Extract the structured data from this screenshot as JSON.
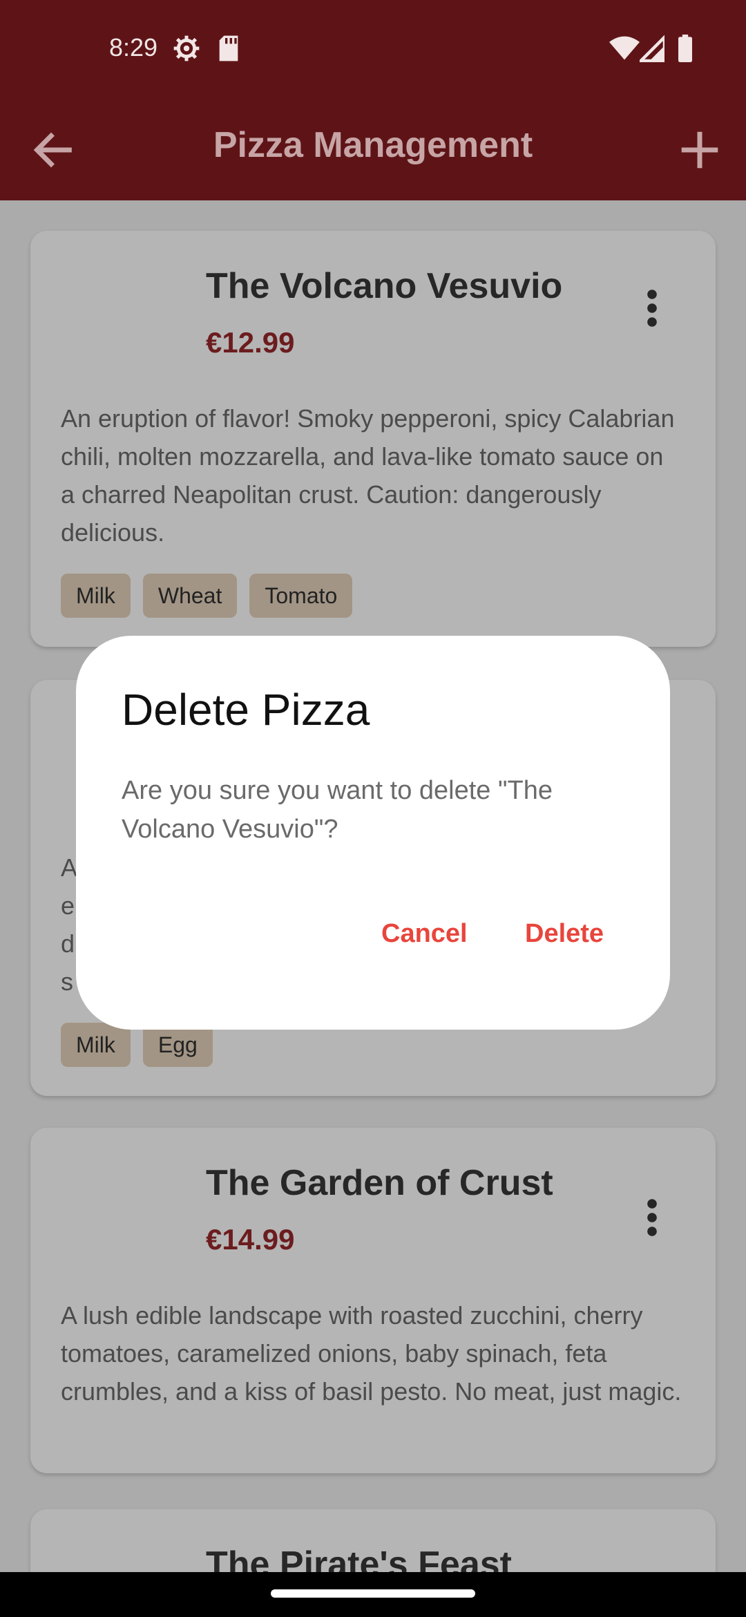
{
  "status_bar": {
    "time": "8:29",
    "icons": [
      "settings-gear-icon",
      "sd-card-icon",
      "wifi-icon",
      "cell-signal-icon",
      "battery-icon"
    ]
  },
  "app_bar": {
    "title": "Pizza Management",
    "back_icon": "arrow-left-icon",
    "add_icon": "plus-icon"
  },
  "pizzas": [
    {
      "name": "The Volcano Vesuvio",
      "price": "€12.99",
      "description": "An eruption of flavor! Smoky pepperoni, spicy Calabrian chili, molten mozzarella, and lava-like tomato sauce on a charred Neapolitan crust. Caution: dangerously delicious.",
      "allergens": [
        "Milk",
        "Wheat",
        "Tomato"
      ]
    },
    {
      "name": "",
      "price": "",
      "description_fragments": [
        "A",
        "e",
        "d",
        "s"
      ],
      "allergens": [
        "Milk",
        "Egg"
      ]
    },
    {
      "name": "The Garden of Crust",
      "price": "€14.99",
      "description": "A lush edible landscape with roasted zucchini, cherry tomatoes, caramelized onions, baby spinach, feta crumbles, and a kiss of basil pesto. No meat, just magic.",
      "allergens": []
    },
    {
      "name": "The Pirate's Feast"
    }
  ],
  "dialog": {
    "title": "Delete Pizza",
    "message": "Are you sure you want to delete \"The Volcano Vesuvio\"?",
    "cancel_label": "Cancel",
    "delete_label": "Delete"
  },
  "colors": {
    "app_bar": "#5e1417",
    "accent_button": "#e8453c",
    "price": "#6c1c1e",
    "chip": "#a29585"
  }
}
